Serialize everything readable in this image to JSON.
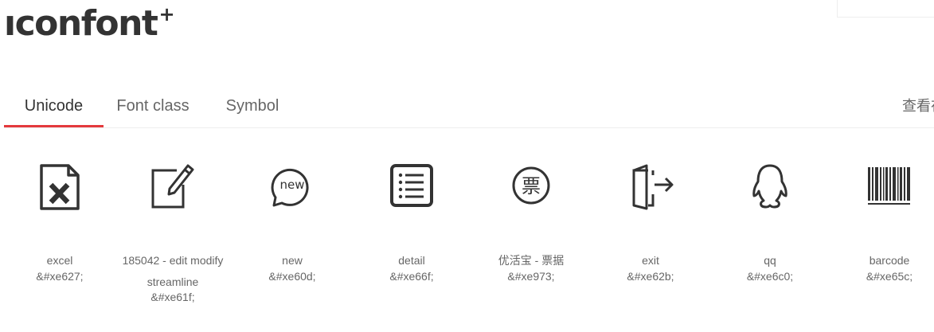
{
  "header": {
    "logo_text": "ıconfont",
    "logo_plus": "+"
  },
  "tabs": [
    {
      "label": "Unicode",
      "active": true
    },
    {
      "label": "Font class",
      "active": false
    },
    {
      "label": "Symbol",
      "active": false
    }
  ],
  "help_link": "查看在线链接",
  "colors": {
    "accent": "#e4393c",
    "text": "#333333",
    "muted": "#666666",
    "divider": "#eeeeee"
  },
  "icons": [
    {
      "name": "excel",
      "code": "&#xe627;",
      "icon": "excel-icon"
    },
    {
      "name": "185042 - edit modify streamline",
      "code": "&#xe61f;",
      "icon": "edit-icon"
    },
    {
      "name": "new",
      "code": "&#xe60d;",
      "icon": "new-bubble-icon"
    },
    {
      "name": "detail",
      "code": "&#xe66f;",
      "icon": "detail-list-icon"
    },
    {
      "name": "优活宝 - 票据",
      "code": "&#xe973;",
      "icon": "ticket-icon"
    },
    {
      "name": "exit",
      "code": "&#xe62b;",
      "icon": "exit-icon"
    },
    {
      "name": "qq",
      "code": "&#xe6c0;",
      "icon": "qq-icon"
    },
    {
      "name": "barcode",
      "code": "&#xe65c;",
      "icon": "barcode-icon"
    }
  ]
}
